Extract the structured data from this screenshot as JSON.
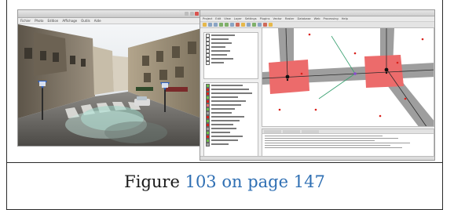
{
  "left_window": {
    "menu": [
      "Fichier",
      "Photo",
      "Edition",
      "Affichage",
      "Outils",
      "Aide"
    ]
  },
  "right_window": {
    "menu": [
      "Project",
      "Edit",
      "View",
      "Layer",
      "Settings",
      "Plugins",
      "Vector",
      "Raster",
      "Database",
      "Web",
      "Processing",
      "Help"
    ]
  },
  "caption": {
    "prefix": "Figure",
    "figure_ref": "103",
    "middle": "on page",
    "page_ref": "147"
  },
  "colors": {
    "link": "#2f6fb3",
    "road": "#9e9e9e",
    "intersection": "#ec6b6b",
    "points": "#d9221c"
  }
}
